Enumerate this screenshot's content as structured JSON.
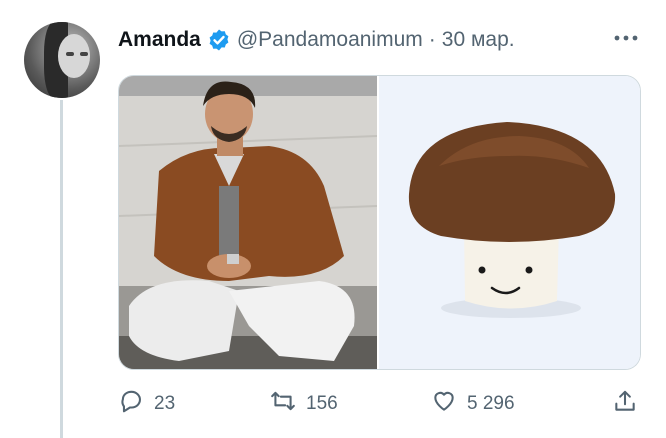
{
  "tweet": {
    "author_name": "Amanda",
    "handle": "@Pandamoanimum",
    "separator": "·",
    "date": "30 мар.",
    "verified_color": "#1d9bf0",
    "media": [
      {
        "icon": "photo-man-sitting"
      },
      {
        "icon": "photo-mushroom-plush"
      }
    ],
    "actions": {
      "replies": "23",
      "retweets": "156",
      "likes": "5 296"
    }
  }
}
